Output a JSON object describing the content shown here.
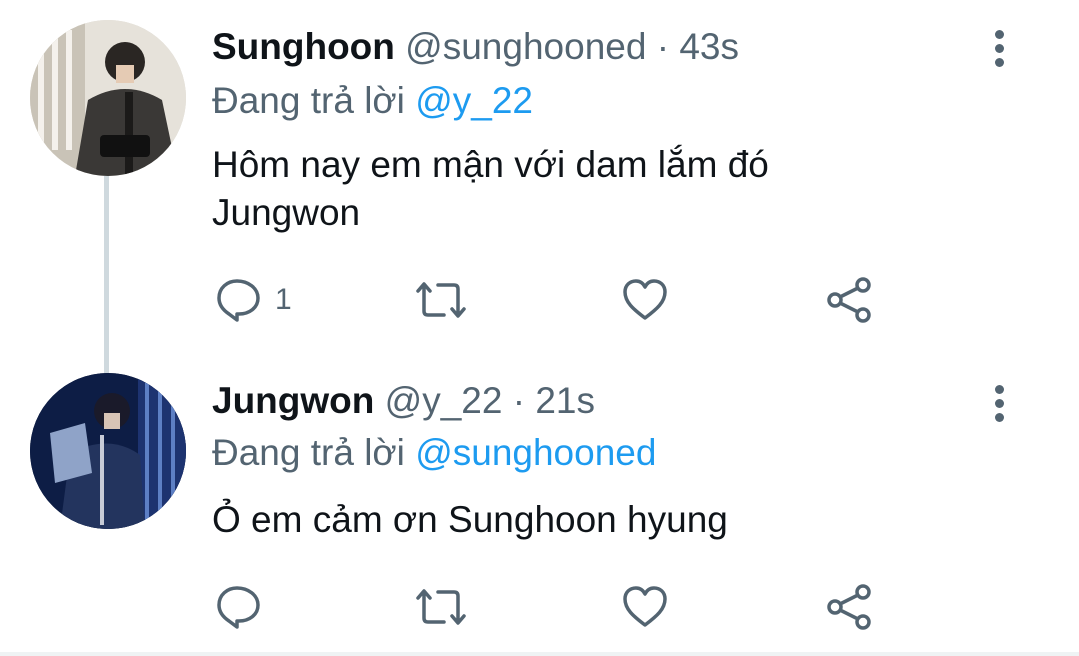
{
  "tweets": [
    {
      "name": "Sunghoon",
      "handle": "@sunghooned",
      "separator": "·",
      "time": "43s",
      "reply_prefix": "Đang trả lời",
      "reply_to": "@y_22",
      "text_lines": [
        "Hôm nay em mận với dam lắm đó",
        "Jungwon"
      ],
      "reply_count": "1"
    },
    {
      "name": "Jungwon",
      "handle": "@y_22",
      "separator": "·",
      "time": "21s",
      "reply_prefix": "Đang trả lời",
      "reply_to": "@sunghooned",
      "text_lines": [
        "Ỏ em cảm ơn Sunghoon hyung"
      ],
      "reply_count": ""
    }
  ],
  "colors": {
    "primary_text": "#0f1419",
    "secondary_text": "#536471",
    "accent": "#1d9bf0",
    "thread_line": "#cfd9de"
  },
  "icons": [
    "reply-icon",
    "retweet-icon",
    "like-icon",
    "share-icon",
    "more-icon"
  ]
}
